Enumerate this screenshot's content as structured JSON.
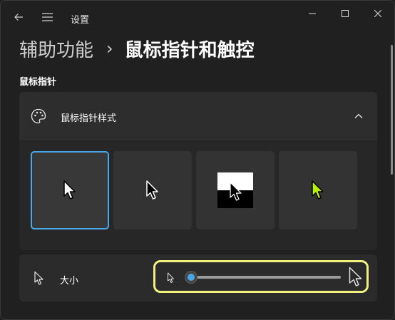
{
  "app": {
    "title": "设置"
  },
  "breadcrumb": {
    "parent": "辅助功能",
    "separator": "›",
    "current": "鼠标指针和触控"
  },
  "section": {
    "title": "鼠标指针"
  },
  "pointer_style": {
    "label": "鼠标指针样式",
    "expanded": true,
    "options": [
      {
        "name": "白色",
        "selected": true
      },
      {
        "name": "黑色",
        "selected": false
      },
      {
        "name": "反转",
        "selected": false
      },
      {
        "name": "自定义",
        "selected": false,
        "color": "#b6f000"
      }
    ]
  },
  "size": {
    "label": "大小",
    "value": 1,
    "min": 1,
    "max": 15
  },
  "colors": {
    "accent": "#4aa8e8",
    "highlight": "#f2ef7f"
  }
}
